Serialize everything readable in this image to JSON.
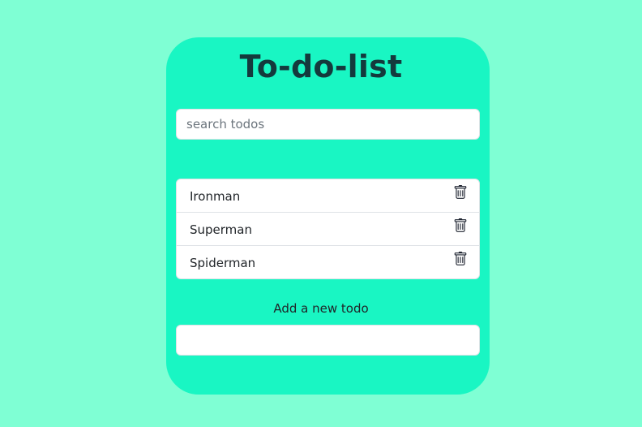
{
  "app": {
    "title": "To-do-list"
  },
  "search": {
    "placeholder": "search todos",
    "value": ""
  },
  "todos": [
    {
      "text": "Ironman",
      "icon": "trash-icon"
    },
    {
      "text": "Superman",
      "icon": "trash-icon"
    },
    {
      "text": "Spiderman",
      "icon": "trash-icon"
    }
  ],
  "add": {
    "label": "Add a new todo",
    "value": ""
  },
  "colors": {
    "page_background": "#7fffd4",
    "card_background": "#19f6c3",
    "title_color": "#143a3d"
  }
}
